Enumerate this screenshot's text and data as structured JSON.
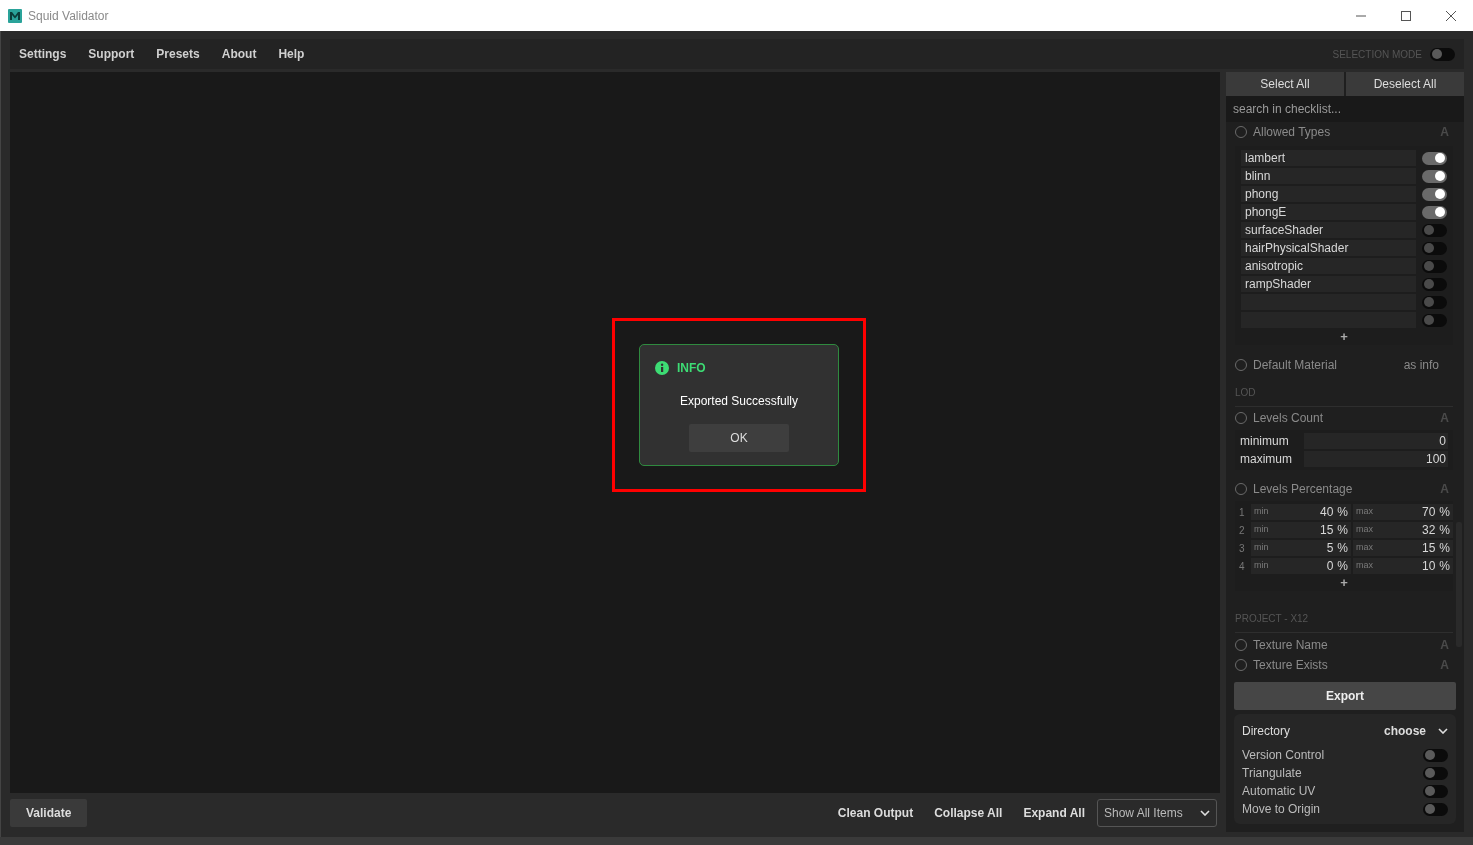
{
  "window": {
    "title": "Squid Validator"
  },
  "menu": [
    "Settings",
    "Support",
    "Presets",
    "About",
    "Help"
  ],
  "selection_mode": {
    "label": "SELECTION MODE",
    "on": false
  },
  "dialog": {
    "title": "INFO",
    "message": "Exported Successfully",
    "button": "OK",
    "highlighted": true
  },
  "panel": {
    "select_all": "Select All",
    "deselect_all": "Deselect All",
    "search": {
      "placeholder": "search in checklist..."
    },
    "checklist": [
      {
        "kind": "toggle_list",
        "label": "Allowed Types",
        "checked": false,
        "mode": "A",
        "add": "+",
        "items": [
          {
            "label": "lambert",
            "on": true
          },
          {
            "label": "blinn",
            "on": true
          },
          {
            "label": "phong",
            "on": true
          },
          {
            "label": "phongE",
            "on": true
          },
          {
            "label": "surfaceShader",
            "on": false
          },
          {
            "label": "hairPhysicalShader",
            "on": false
          },
          {
            "label": "anisotropic",
            "on": false
          },
          {
            "label": "rampShader",
            "on": false
          },
          {
            "on": false
          },
          {
            "on": false
          }
        ]
      },
      {
        "kind": "check",
        "label": "Default Material",
        "checked": false,
        "value": "as info"
      },
      {
        "kind": "heading",
        "label": "LOD"
      },
      {
        "kind": "range",
        "label": "Levels Count",
        "checked": false,
        "mode": "A",
        "rows": [
          {
            "label": "minimum",
            "value": "0"
          },
          {
            "label": "maximum",
            "value": "100"
          }
        ]
      },
      {
        "kind": "percent",
        "label": "Levels Percentage",
        "checked": false,
        "mode": "A",
        "add": "+",
        "rows": [
          {
            "index": "1",
            "min_label": "min",
            "min": "40",
            "min_unit": "%",
            "max_label": "max",
            "max": "70",
            "max_unit": "%"
          },
          {
            "index": "2",
            "min_label": "min",
            "min": "15",
            "min_unit": "%",
            "max_label": "max",
            "max": "32",
            "max_unit": "%"
          },
          {
            "index": "3",
            "min_label": "min",
            "min": "5",
            "min_unit": "%",
            "max_label": "max",
            "max": "15",
            "max_unit": "%"
          },
          {
            "index": "4",
            "min_label": "min",
            "min": "0",
            "min_unit": "%",
            "max_label": "max",
            "max": "10",
            "max_unit": "%"
          }
        ]
      },
      {
        "kind": "heading",
        "label": "PROJECT - X12"
      },
      {
        "kind": "check",
        "label": "Texture Name",
        "checked": false,
        "mode": "A"
      },
      {
        "kind": "check",
        "label": "Texture Exists",
        "checked": false,
        "mode": "A"
      }
    ],
    "export": {
      "button": "Export",
      "directory": {
        "label": "Directory",
        "value": "choose"
      },
      "options": [
        {
          "label": "Version Control",
          "on": false
        },
        {
          "label": "Triangulate",
          "on": false
        },
        {
          "label": "Automatic UV",
          "on": false
        },
        {
          "label": "Move to Origin",
          "on": false
        }
      ]
    }
  },
  "bottom": {
    "validate": "Validate",
    "actions": [
      "Clean Output",
      "Collapse All",
      "Expand All"
    ],
    "filter": "Show All Items"
  }
}
